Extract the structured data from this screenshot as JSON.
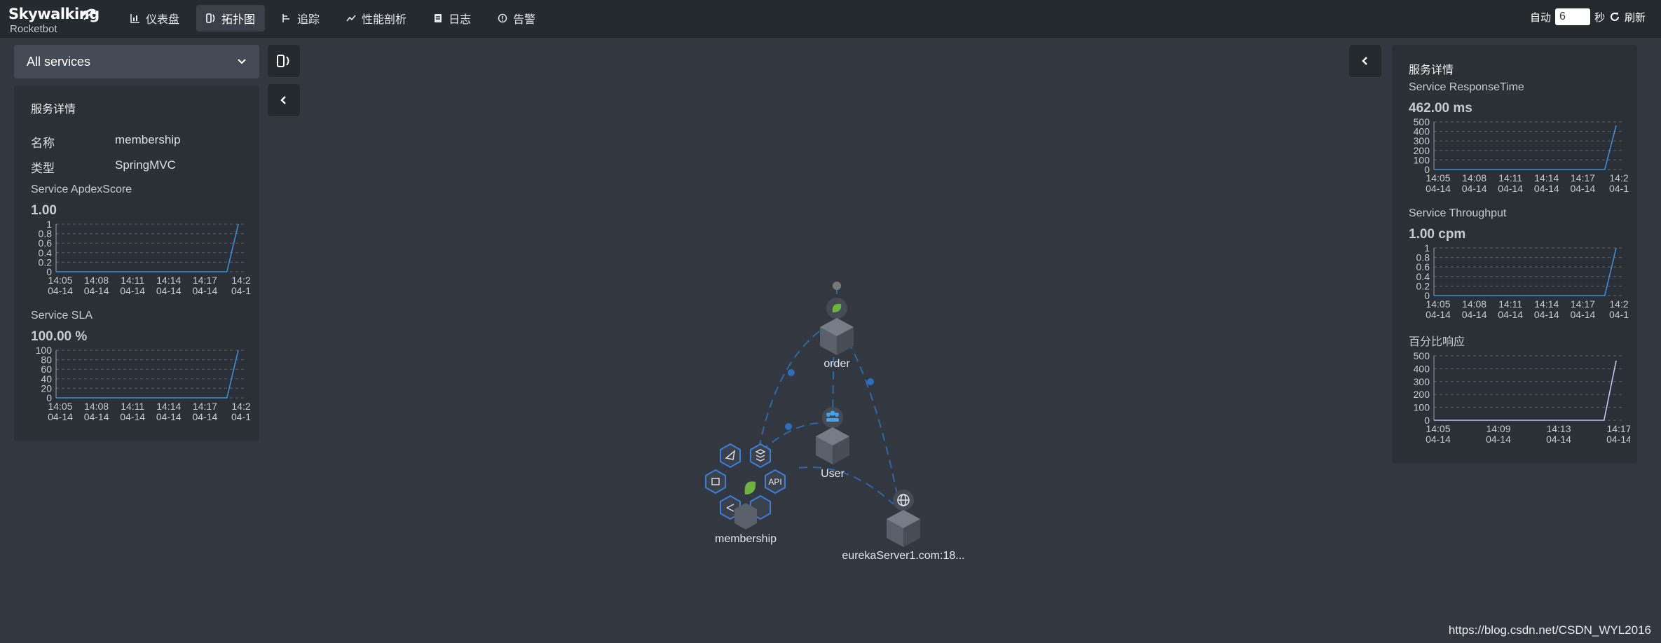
{
  "app": {
    "logo_main": "Skywalking",
    "logo_sub": "Rocketbot"
  },
  "nav": [
    {
      "label": "仪表盘",
      "icon": "bar-chart-icon"
    },
    {
      "label": "拓扑图",
      "icon": "topology-icon"
    },
    {
      "label": "追踪",
      "icon": "trace-icon"
    },
    {
      "label": "性能剖析",
      "icon": "line-chart-icon"
    },
    {
      "label": "日志",
      "icon": "log-icon"
    },
    {
      "label": "告警",
      "icon": "alarm-icon"
    }
  ],
  "auto_refresh": {
    "label": "自动",
    "value": "6",
    "unit": "秒",
    "refresh_label": "刷新"
  },
  "service_select": {
    "value": "All services"
  },
  "left_panel": {
    "title": "服务详情",
    "name_label": "名称",
    "name_value": "membership",
    "type_label": "类型",
    "type_value": "SpringMVC",
    "apdex": {
      "title": "Service ApdexScore",
      "value": "1.00"
    },
    "sla": {
      "title": "Service SLA",
      "value": "100.00 %"
    }
  },
  "right_panel": {
    "title": "服务详情",
    "resp": {
      "title": "Service ResponseTime",
      "value": "462.00 ms"
    },
    "thru": {
      "title": "Service Throughput",
      "value": "1.00 cpm"
    },
    "pct": {
      "title": "百分比响应"
    }
  },
  "topology": {
    "nodes": [
      "order",
      "User",
      "membership",
      "eurekaServer1.com:18..."
    ]
  },
  "watermark": "https://blog.csdn.net/CSDN_WYL2016",
  "colors": {
    "line": "#3d8fd6",
    "pct_line": "#c8c2f0",
    "bg": "#333840",
    "panel": "#2b3037"
  },
  "chart_data": [
    {
      "type": "line",
      "title": "Service ApdexScore",
      "x": [
        "14:05\n04-14",
        "14:08\n04-14",
        "14:11\n04-14",
        "14:14\n04-14",
        "14:17\n04-14",
        "14:2\n04-1"
      ],
      "yticks": [
        "0",
        "0.2",
        "0.4",
        "0.6",
        "0.8",
        "1"
      ],
      "ylim": [
        0,
        1
      ],
      "series": [
        {
          "values": [
            0,
            0,
            0,
            0,
            0,
            0,
            0,
            0,
            0,
            0,
            0,
            0,
            0,
            0,
            0,
            0,
            1
          ]
        }
      ]
    },
    {
      "type": "line",
      "title": "Service SLA",
      "x": [
        "14:05\n04-14",
        "14:08\n04-14",
        "14:11\n04-14",
        "14:14\n04-14",
        "14:17\n04-14",
        "14:2\n04-1"
      ],
      "yticks": [
        "0",
        "20",
        "40",
        "60",
        "80",
        "100"
      ],
      "ylim": [
        0,
        100
      ],
      "series": [
        {
          "values": [
            0,
            0,
            0,
            0,
            0,
            0,
            0,
            0,
            0,
            0,
            0,
            0,
            0,
            0,
            0,
            0,
            100
          ]
        }
      ]
    },
    {
      "type": "line",
      "title": "Service ResponseTime",
      "x": [
        "14:05\n04-14",
        "14:08\n04-14",
        "14:11\n04-14",
        "14:14\n04-14",
        "14:17\n04-14",
        "14:2\n04-1"
      ],
      "yticks": [
        "0",
        "100",
        "200",
        "300",
        "400",
        "500"
      ],
      "ylim": [
        0,
        500
      ],
      "series": [
        {
          "values": [
            0,
            0,
            0,
            0,
            0,
            0,
            0,
            0,
            0,
            0,
            0,
            0,
            0,
            0,
            0,
            0,
            462
          ]
        }
      ]
    },
    {
      "type": "line",
      "title": "Service Throughput",
      "x": [
        "14:05\n04-14",
        "14:08\n04-14",
        "14:11\n04-14",
        "14:14\n04-14",
        "14:17\n04-14",
        "14:2\n04-1"
      ],
      "yticks": [
        "0",
        "0.2",
        "0.4",
        "0.6",
        "0.8",
        "1"
      ],
      "ylim": [
        0,
        1
      ],
      "series": [
        {
          "values": [
            0,
            0,
            0,
            0,
            0,
            0,
            0,
            0,
            0,
            0,
            0,
            0,
            0,
            0,
            0,
            0,
            1
          ]
        }
      ]
    },
    {
      "type": "line",
      "title": "百分比响应",
      "x": [
        "14:05\n04-14",
        "14:09\n04-14",
        "14:13\n04-14",
        "14:17\n04-14"
      ],
      "yticks": [
        "0",
        "100",
        "200",
        "300",
        "400",
        "500"
      ],
      "ylim": [
        0,
        500
      ],
      "series": [
        {
          "values": [
            0,
            0,
            0,
            0,
            0,
            0,
            0,
            0,
            0,
            0,
            0,
            0,
            0,
            0,
            0,
            462
          ]
        }
      ]
    }
  ]
}
